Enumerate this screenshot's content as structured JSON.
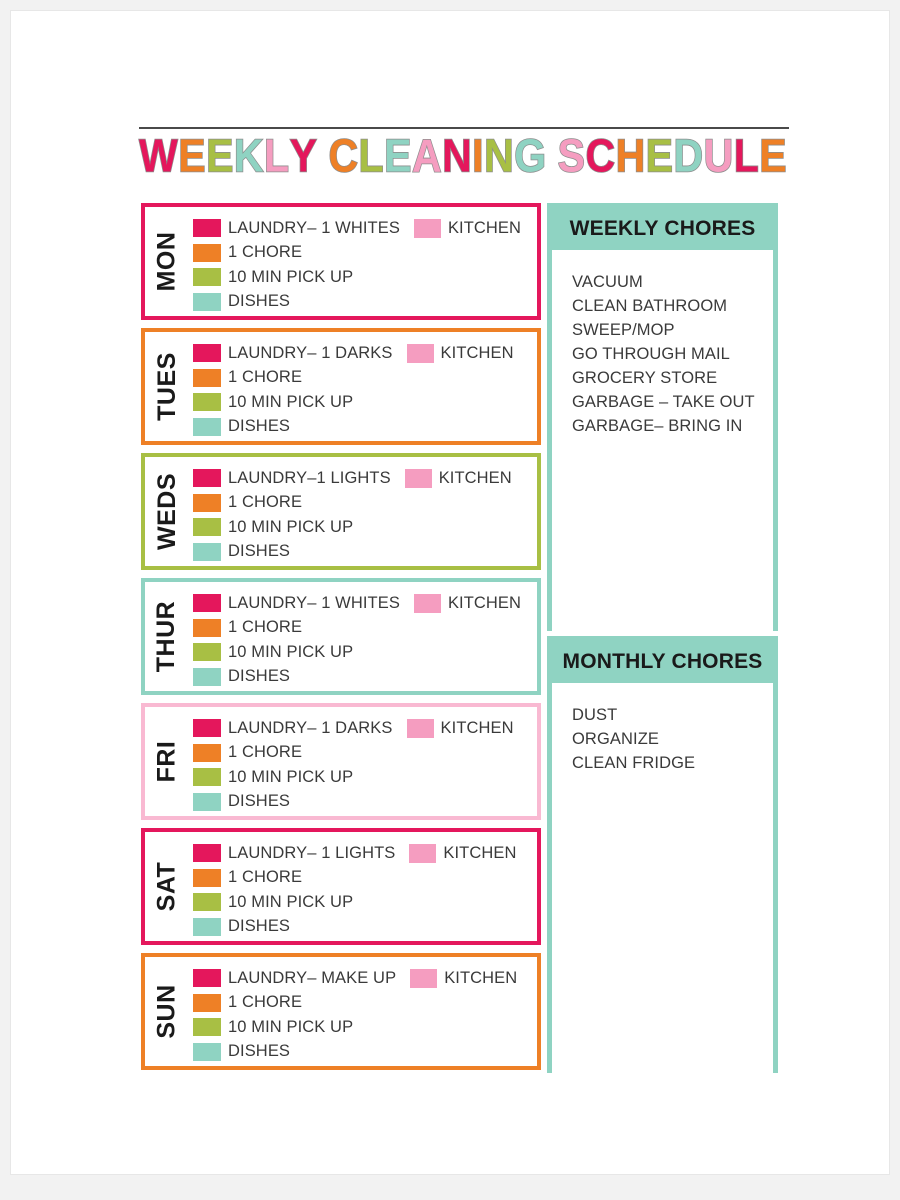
{
  "title": {
    "text": "WEEKLY CLEANING SCHEDULE",
    "letters": [
      {
        "c": "W",
        "color": "#E4175C"
      },
      {
        "c": "E",
        "color": "#EE8026"
      },
      {
        "c": "E",
        "color": "#A8BF44"
      },
      {
        "c": "K",
        "color": "#8FD3C2"
      },
      {
        "c": "L",
        "color": "#F59DC0"
      },
      {
        "c": "Y",
        "color": "#E4175C"
      },
      {
        "c": " ",
        "color": ""
      },
      {
        "c": "C",
        "color": "#EE8026"
      },
      {
        "c": "L",
        "color": "#A8BF44"
      },
      {
        "c": "E",
        "color": "#8FD3C2"
      },
      {
        "c": "A",
        "color": "#F59DC0"
      },
      {
        "c": "N",
        "color": "#E4175C"
      },
      {
        "c": "I",
        "color": "#EE8026"
      },
      {
        "c": "N",
        "color": "#A8BF44"
      },
      {
        "c": "G",
        "color": "#8FD3C2"
      },
      {
        "c": " ",
        "color": ""
      },
      {
        "c": "S",
        "color": "#F59DC0"
      },
      {
        "c": "C",
        "color": "#E4175C"
      },
      {
        "c": "H",
        "color": "#EE8026"
      },
      {
        "c": "E",
        "color": "#A8BF44"
      },
      {
        "c": "D",
        "color": "#8FD3C2"
      },
      {
        "c": "U",
        "color": "#F59DC0"
      },
      {
        "c": "L",
        "color": "#E4175C"
      },
      {
        "c": "E",
        "color": "#EE8026"
      }
    ]
  },
  "colors": {
    "crimson": "#E4175C",
    "orange": "#EE8026",
    "olive": "#A8BF44",
    "mint": "#8FD3C2",
    "pink": "#F59DC0",
    "chip_laundry": "#E4175C",
    "chip_chore": "#EE8026",
    "chip_pickup": "#A8BF44",
    "chip_dishes": "#8FD3C2",
    "chip_kitchen": "#F59DC0",
    "text": "#3a3a3a",
    "rule": "#4a4a4a"
  },
  "kitchen_label": "KITCHEN",
  "days": [
    {
      "day": "MON",
      "border": "#E4175C",
      "tasks": [
        {
          "label": "LAUNDRY– 1 WHITES",
          "chip": "#E4175C"
        },
        {
          "label": "1 CHORE",
          "chip": "#EE8026"
        },
        {
          "label": "10 MIN PICK UP",
          "chip": "#A8BF44"
        },
        {
          "label": "DISHES",
          "chip": "#8FD3C2"
        }
      ],
      "kitchen": "KITCHEN"
    },
    {
      "day": "TUES",
      "border": "#EE8026",
      "tasks": [
        {
          "label": "LAUNDRY– 1 DARKS",
          "chip": "#E4175C"
        },
        {
          "label": "1 CHORE",
          "chip": "#EE8026"
        },
        {
          "label": "10 MIN PICK UP",
          "chip": "#A8BF44"
        },
        {
          "label": "DISHES",
          "chip": "#8FD3C2"
        }
      ],
      "kitchen": "KITCHEN"
    },
    {
      "day": "WEDS",
      "border": "#A8BF44",
      "tasks": [
        {
          "label": "LAUNDRY–1 LIGHTS",
          "chip": "#E4175C"
        },
        {
          "label": "1 CHORE",
          "chip": "#EE8026"
        },
        {
          "label": "10 MIN PICK UP",
          "chip": "#A8BF44"
        },
        {
          "label": "DISHES",
          "chip": "#8FD3C2"
        }
      ],
      "kitchen": "KITCHEN"
    },
    {
      "day": "THUR",
      "border": "#8FD3C2",
      "tasks": [
        {
          "label": "LAUNDRY– 1 WHITES",
          "chip": "#E4175C"
        },
        {
          "label": "1 CHORE",
          "chip": "#EE8026"
        },
        {
          "label": "10 MIN PICK UP",
          "chip": "#A8BF44"
        },
        {
          "label": "DISHES",
          "chip": "#8FD3C2"
        }
      ],
      "kitchen": "KITCHEN"
    },
    {
      "day": "FRI",
      "border": "#F9B9D2",
      "tasks": [
        {
          "label": "LAUNDRY– 1 DARKS",
          "chip": "#E4175C"
        },
        {
          "label": "1 CHORE",
          "chip": "#EE8026"
        },
        {
          "label": "10 MIN PICK UP",
          "chip": "#A8BF44"
        },
        {
          "label": "DISHES",
          "chip": "#8FD3C2"
        }
      ],
      "kitchen": "KITCHEN"
    },
    {
      "day": "SAT",
      "border": "#E4175C",
      "tasks": [
        {
          "label": "LAUNDRY– 1 LIGHTS",
          "chip": "#E4175C"
        },
        {
          "label": "1 CHORE",
          "chip": "#EE8026"
        },
        {
          "label": "10 MIN PICK UP",
          "chip": "#A8BF44"
        },
        {
          "label": "DISHES",
          "chip": "#8FD3C2"
        }
      ],
      "kitchen": "KITCHEN"
    },
    {
      "day": "SUN",
      "border": "#EE8026",
      "tasks": [
        {
          "label": "LAUNDRY– MAKE UP",
          "chip": "#E4175C"
        },
        {
          "label": "1 CHORE",
          "chip": "#EE8026"
        },
        {
          "label": "10 MIN PICK UP",
          "chip": "#A8BF44"
        },
        {
          "label": "DISHES",
          "chip": "#8FD3C2"
        }
      ],
      "kitchen": "KITCHEN"
    }
  ],
  "panels": [
    {
      "id": "weekly",
      "header": "WEEKLY CHORES",
      "items": [
        "VACUUM",
        "CLEAN BATHROOM",
        "SWEEP/MOP",
        "GO THROUGH MAIL",
        "GROCERY STORE",
        "GARBAGE – TAKE OUT",
        "GARBAGE– BRING IN"
      ]
    },
    {
      "id": "monthly",
      "header": "MONTHLY CHORES",
      "items": [
        "DUST",
        "ORGANIZE",
        "CLEAN FRIDGE"
      ]
    }
  ]
}
